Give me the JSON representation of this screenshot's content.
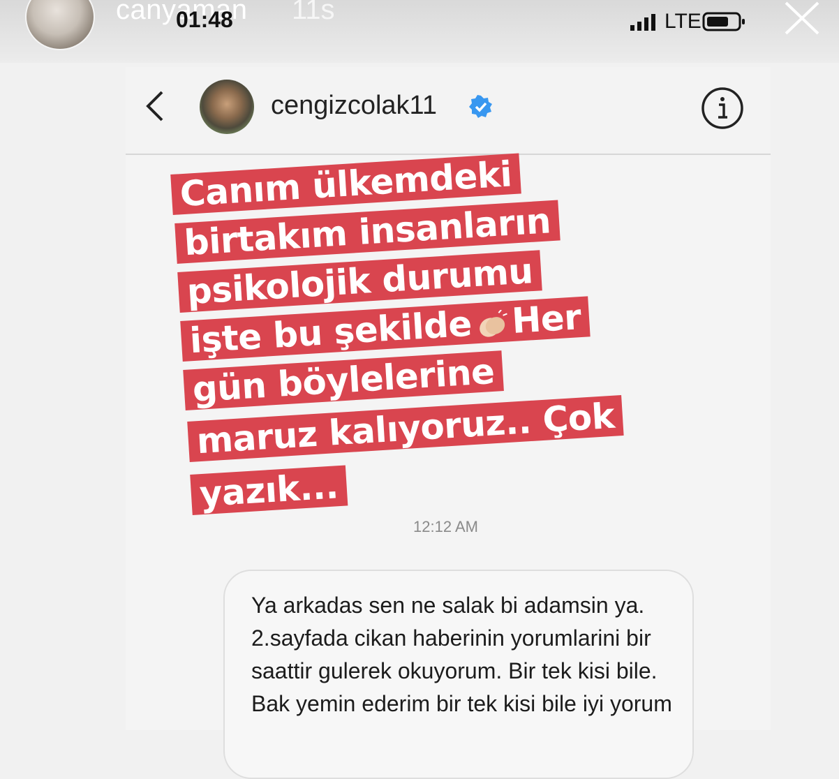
{
  "story": {
    "username": "canyaman",
    "time_ago": "11s",
    "status_time": "01:48",
    "network": "LTE",
    "icons": [
      "signal-icon",
      "battery-icon",
      "close-icon"
    ]
  },
  "dm_header": {
    "username": "cengizcolak11",
    "verified": true,
    "icons": [
      "back-icon",
      "verified-icon",
      "info-icon"
    ]
  },
  "sticker": {
    "lines": [
      "Canım ülkemdeki",
      "birtakım insanların",
      "psikolojik durumu",
      "işte bu şekilde",
      "Her",
      "gün böylelerine",
      "maruz kalıyoruz.. Çok",
      "yazık..."
    ],
    "emoji": "clapping-hands-icon",
    "background_color": "#d9454f"
  },
  "message": {
    "timestamp": "12:12 AM",
    "text": "Ya arkadas sen ne salak bi adamsin ya. 2.sayfada cikan haberinin yorumlarini bir saattir gulerek okuyorum. Bir tek kisi bile. Bak yemin ederim bir tek kisi bile iyi yorum"
  }
}
